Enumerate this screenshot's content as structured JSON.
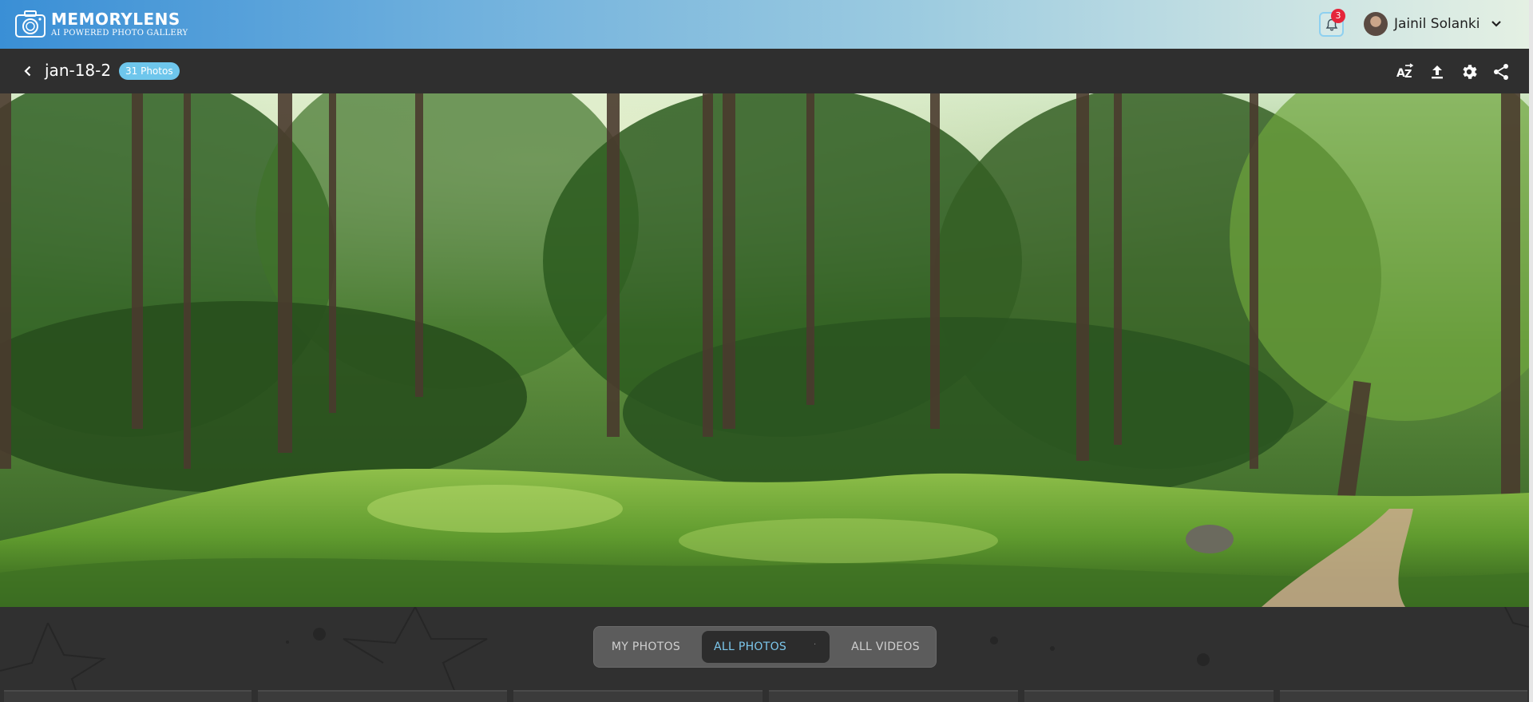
{
  "app": {
    "logo_title": "MEMORYLENS",
    "logo_subtitle": "AI POWERED PHOTO GALLERY"
  },
  "header": {
    "notifications_count": "3",
    "user_name": "Jainil Solanki"
  },
  "album": {
    "title": "jan-18-2",
    "photo_count": "31 Photos"
  },
  "toolbar": {
    "icons": [
      "sort-az-icon",
      "upload-icon",
      "settings-icon",
      "share-icon"
    ]
  },
  "tabs": [
    {
      "label": "MY PHOTOS",
      "active": false
    },
    {
      "label": "ALL PHOTOS",
      "active": true
    },
    {
      "label": "ALL VIDEOS",
      "active": false
    }
  ],
  "tab_separator": "·",
  "colors": {
    "accent": "#6ec6ec",
    "badge": "#e5253a",
    "bar_bg": "#2f2f2f"
  }
}
